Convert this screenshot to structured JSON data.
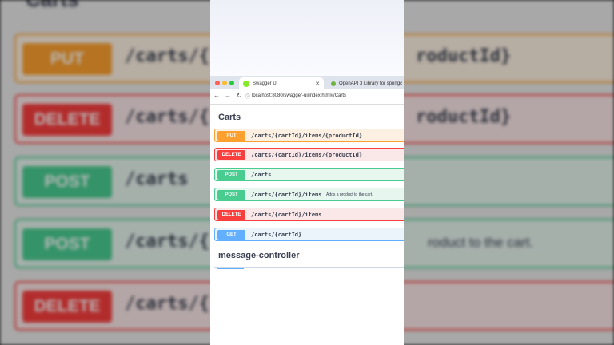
{
  "background": {
    "section_title": "Carts",
    "rows": [
      {
        "method": "PUT",
        "path": "/carts/{",
        "right": "roductId}"
      },
      {
        "method": "DELETE",
        "path": "/carts/{",
        "right": "roductId}"
      },
      {
        "method": "POST",
        "path": "/carts",
        "right": ""
      },
      {
        "method": "POST",
        "path": "/carts/{",
        "right": "",
        "desc": "roduct to the cart."
      },
      {
        "method": "DELETE",
        "path": "/carts/{",
        "right": ""
      }
    ]
  },
  "browser": {
    "tabs": [
      {
        "label": "Swagger UI",
        "favicon_color": "#85ea2d"
      },
      {
        "label": "OpenAPI 3 Library for spring",
        "favicon_color": "#6db33f"
      }
    ],
    "url": "localhost:8080/swagger-ui/index.html#/Carts"
  },
  "swagger": {
    "section": "Carts",
    "operations": [
      {
        "method": "PUT",
        "path": "/carts/{cartId}/items/{productId}",
        "desc": ""
      },
      {
        "method": "DELETE",
        "path": "/carts/{cartId}/items/{productId}",
        "desc": ""
      },
      {
        "method": "POST",
        "path": "/carts",
        "desc": ""
      },
      {
        "method": "POST",
        "path": "/carts/{cartId}/items",
        "desc": "Adds a product to the cart."
      },
      {
        "method": "DELETE",
        "path": "/carts/{cartId}/items",
        "desc": ""
      },
      {
        "method": "GET",
        "path": "/carts/{cartId}",
        "desc": ""
      }
    ],
    "next_section": "message-controller"
  },
  "colors": {
    "put": "#fca130",
    "delete": "#f93e3e",
    "post": "#49cc90",
    "get": "#61affe"
  }
}
